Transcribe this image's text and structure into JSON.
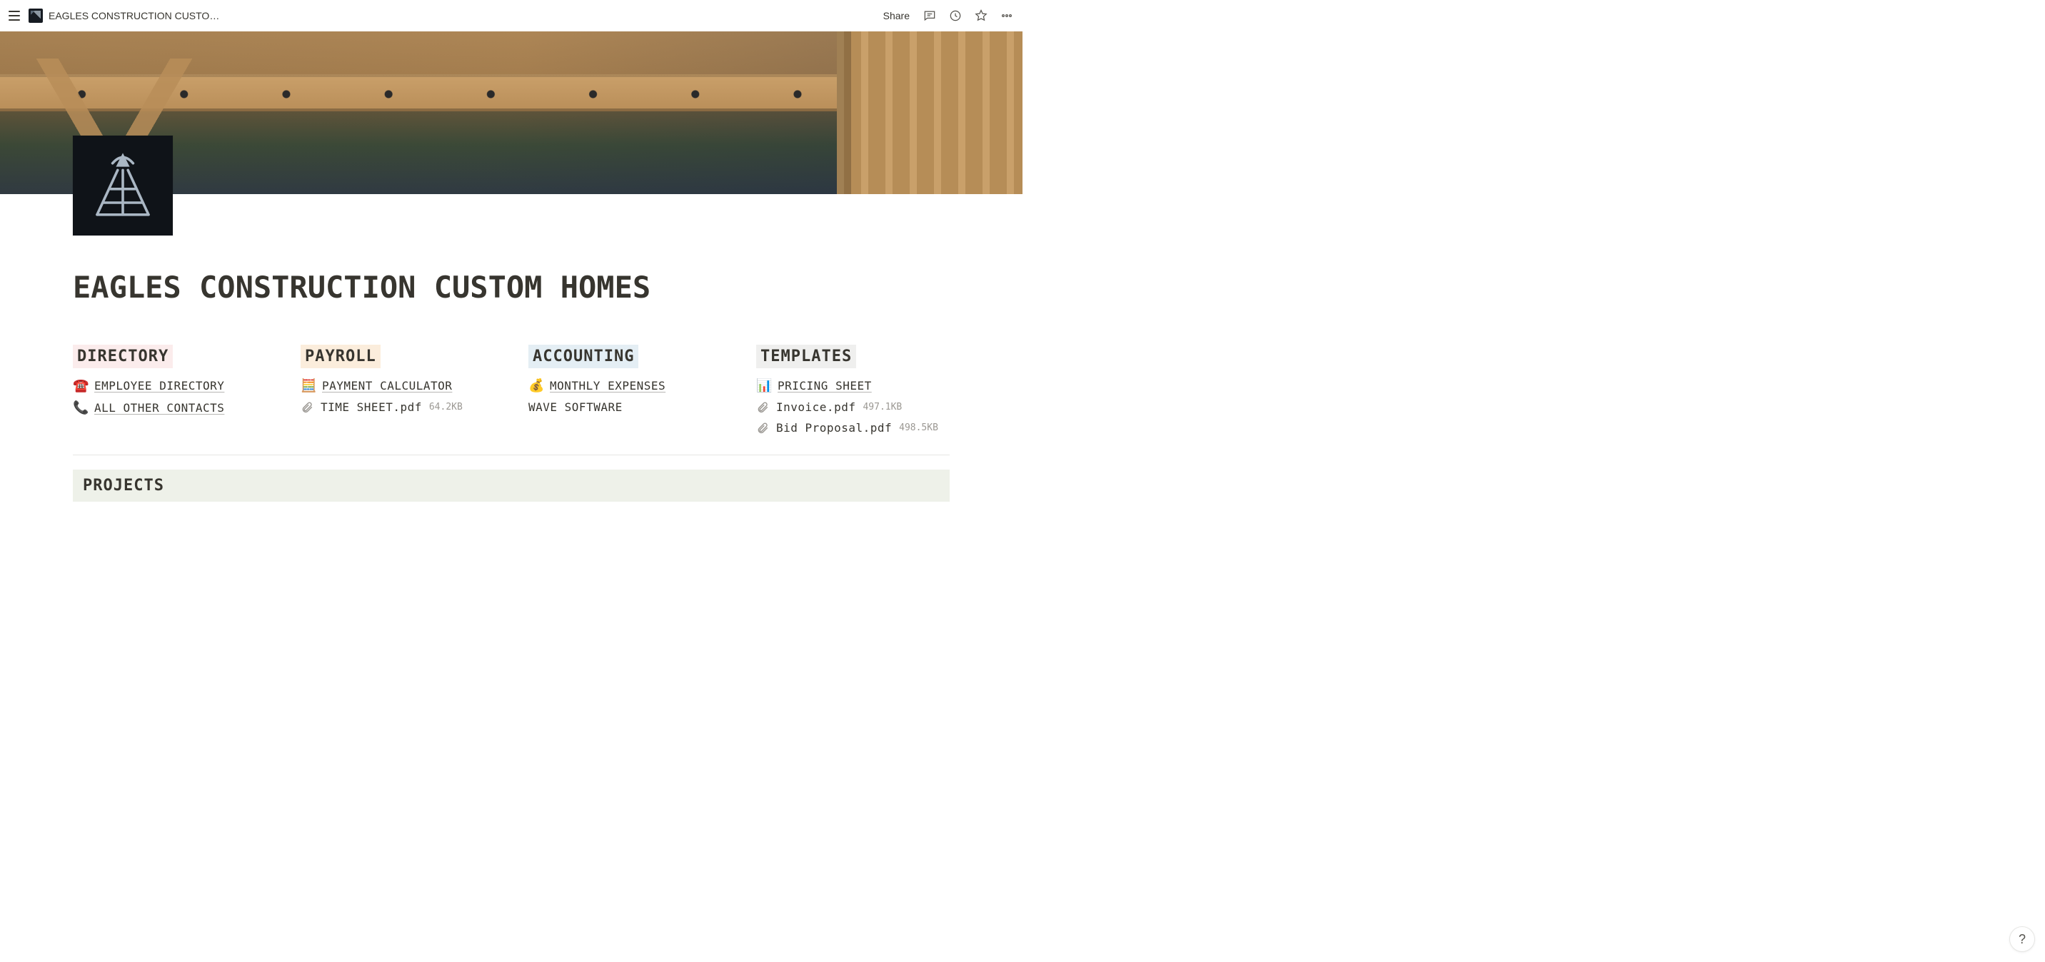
{
  "topbar": {
    "breadcrumb_title": "EAGLES CONSTRUCTION CUSTO…",
    "share_label": "Share"
  },
  "page": {
    "title": "EAGLES CONSTRUCTION CUSTOM HOMES"
  },
  "columns": {
    "directory": {
      "heading": "DIRECTORY",
      "items": [
        {
          "emoji": "☎️",
          "label": "EMPLOYEE DIRECTORY",
          "type": "page"
        },
        {
          "emoji": "📞",
          "label": "ALL OTHER CONTACTS",
          "type": "page"
        }
      ]
    },
    "payroll": {
      "heading": "PAYROLL",
      "items": [
        {
          "emoji": "🧮",
          "label": "PAYMENT CALCULATOR",
          "type": "page"
        },
        {
          "icon": "clip",
          "label": "TIME SHEET.pdf",
          "size": "64.2KB",
          "type": "file"
        }
      ]
    },
    "accounting": {
      "heading": "ACCOUNTING",
      "items": [
        {
          "emoji": "💰",
          "label": "MONTHLY EXPENSES",
          "type": "page"
        },
        {
          "label": "WAVE SOFTWARE",
          "type": "text"
        }
      ]
    },
    "templates": {
      "heading": "TEMPLATES",
      "items": [
        {
          "emoji": "📊",
          "label": "PRICING SHEET",
          "type": "page"
        },
        {
          "icon": "clip",
          "label": "Invoice.pdf",
          "size": "497.1KB",
          "type": "file"
        },
        {
          "icon": "clip",
          "label": "Bid Proposal.pdf",
          "size": "498.5KB",
          "type": "file"
        }
      ]
    }
  },
  "projects": {
    "heading": "PROJECTS"
  },
  "help": {
    "label": "?"
  }
}
